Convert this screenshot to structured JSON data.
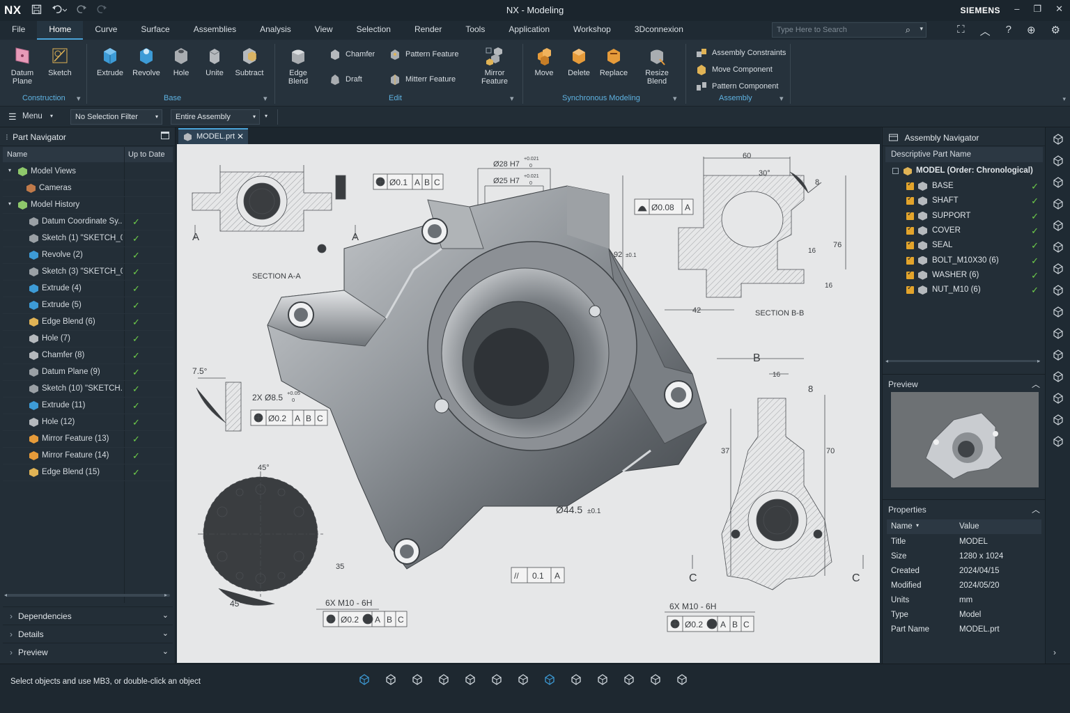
{
  "app": {
    "logo": "NX",
    "title": "NX - Modeling",
    "brand": "SIEMENS"
  },
  "quick_access": {
    "save_icon": "save-icon",
    "undo_icon": "undo-icon",
    "redo_icon": "redo-icon"
  },
  "window_controls": {
    "minimize": "–",
    "restore": "❐",
    "close": "✕"
  },
  "menubar": {
    "items": [
      "File",
      "Home",
      "Curve",
      "Surface",
      "Assemblies",
      "Analysis",
      "View",
      "Selection",
      "Render",
      "Tools",
      "Application",
      "Workshop",
      "3Dconnexion"
    ],
    "active": "Home"
  },
  "search": {
    "placeholder": "Type Here to Search"
  },
  "ribbon": {
    "construction": {
      "group": "Construction",
      "datum_plane": "Datum Plane",
      "sketch": "Sketch"
    },
    "base": {
      "group": "Base",
      "extrude": "Extrude",
      "revolve": "Revolve",
      "hole": "Hole",
      "unite": "Unite",
      "subtract": "Subtract"
    },
    "edit": {
      "group": "Edit",
      "edge_blend": "Edge Blend",
      "chamfer": "Chamfer",
      "draft": "Draft",
      "pattern_feature": "Pattern Feature",
      "mirror_feature_small": "Mitterr Feature",
      "mirror_feature": "Mirror Feature"
    },
    "sync": {
      "group": "Synchronous Modeling",
      "move": "Move",
      "delete": "Delete",
      "replace": "Replace",
      "resize_blend": "Resize Blend"
    },
    "assembly": {
      "group": "Assembly",
      "constraints": "Assembly Constraints",
      "move_component": "Move Component",
      "pattern_component": "Pattern Component"
    }
  },
  "toolbar": {
    "menu_label": "Menu",
    "selection_filter": "No Selection Filter",
    "scope": "Entire Assembly"
  },
  "part_navigator": {
    "title": "Part Navigator",
    "col_name": "Name",
    "col_uptodate": "Up to Date",
    "rows": [
      {
        "label": "Model Views",
        "icon": "model-views-icon",
        "check": ""
      },
      {
        "label": "Cameras",
        "icon": "cameras-icon",
        "check": ""
      },
      {
        "label": "Model History",
        "icon": "model-history-icon",
        "check": ""
      },
      {
        "label": "Datum Coordinate Sy...",
        "icon": "datum-csys-icon",
        "check": "✓"
      },
      {
        "label": "Sketch (1) \"SKETCH_0...",
        "icon": "sketch-icon",
        "check": "✓"
      },
      {
        "label": "Revolve (2)",
        "icon": "revolve-icon",
        "check": "✓"
      },
      {
        "label": "Sketch (3) \"SKETCH_0...",
        "icon": "sketch-icon",
        "check": "✓"
      },
      {
        "label": "Extrude (4)",
        "icon": "extrude-icon",
        "check": "✓"
      },
      {
        "label": "Extrude (5)",
        "icon": "extrude-icon",
        "check": "✓"
      },
      {
        "label": "Edge Blend (6)",
        "icon": "edge-blend-icon",
        "check": "✓"
      },
      {
        "label": "Hole (7)",
        "icon": "hole-icon",
        "check": "✓"
      },
      {
        "label": "Chamfer (8)",
        "icon": "chamfer-icon",
        "check": "✓"
      },
      {
        "label": "Datum Plane (9)",
        "icon": "datum-plane-icon",
        "check": "✓"
      },
      {
        "label": "Sketch (10) \"SKETCH...",
        "icon": "sketch-icon",
        "check": "✓"
      },
      {
        "label": "Extrude (11)",
        "icon": "extrude-icon",
        "check": "✓"
      },
      {
        "label": "Hole (12)",
        "icon": "hole-icon",
        "check": "✓"
      },
      {
        "label": "Mirror Feature (13)",
        "icon": "mirror-feature-icon",
        "check": "✓"
      },
      {
        "label": "Mirror Feature (14)",
        "icon": "mirror-feature-icon",
        "check": "✓"
      },
      {
        "label": "Edge Blend (15)",
        "icon": "edge-blend-icon",
        "check": "✓"
      }
    ],
    "sections": [
      "Dependencies",
      "Details",
      "Preview"
    ]
  },
  "document_tab": {
    "label": "MODEL.prt"
  },
  "drawing": {
    "section_aa": "SECTION A-A",
    "section_bb": "SECTION B-B",
    "label_a": "A",
    "label_b": "B",
    "label_c": "C",
    "fcf_top": [
      "Ø0.1",
      "A",
      "B",
      "C"
    ],
    "dim_28": "Ø28 H7",
    "tol_28_upper": "+0.021",
    "tol_28_lower": "0",
    "dim_25": "Ø25 H7",
    "tol_25_upper": "+0.021",
    "tol_25_lower": "0",
    "profile_fcf": [
      "Ø0.08",
      "A"
    ],
    "dim_60": "60",
    "dim_30deg": "30°",
    "dim_8": "8",
    "dim_92": "92",
    "tol_92": "±0.1",
    "dim_76": "76",
    "dim_16": "16",
    "dim_42": "42",
    "dim_75deg": "7.5°",
    "hole_2x": "2X Ø8.5",
    "tol_hole_upper": "+0.05",
    "tol_hole_lower": "0",
    "fcf_hole": [
      "Ø0.2",
      "A",
      "B",
      "C"
    ],
    "dim_45deg": "45°",
    "dim_35": "35",
    "dim_44": "Ø44.5",
    "tol_44": "±0.1",
    "parallel_fcf": [
      "//",
      "0.1",
      "A"
    ],
    "thread_left": "6X M10 - 6H",
    "fcf_thread_left": [
      "Ø0.2",
      "M",
      "A",
      "B",
      "C"
    ],
    "thread_right": "6X M10 - 6H",
    "fcf_thread_right": [
      "Ø0.2",
      "M",
      "A",
      "B",
      "C"
    ],
    "dim_37": "37",
    "dim_70": "70",
    "square_icon": "square-datum-icon"
  },
  "assembly_navigator": {
    "title": "Assembly Navigator",
    "column": "Descriptive Part Name",
    "root": "MODEL (Order: Chronological)",
    "items": [
      "BASE",
      "SHAFT",
      "SUPPORT",
      "COVER",
      "SEAL",
      "BOLT_M10X30 (6)",
      "WASHER (6)",
      "NUT_M10 (6)"
    ]
  },
  "preview_panel": {
    "title": "Preview"
  },
  "properties": {
    "title": "Properties",
    "col_name": "Name",
    "col_value": "Value",
    "rows": [
      {
        "name": "Title",
        "value": "MODEL"
      },
      {
        "name": "Size",
        "value": "1280 x 1024"
      },
      {
        "name": "Created",
        "value": "2024/04/15"
      },
      {
        "name": "Modified",
        "value": "2024/05/20"
      },
      {
        "name": "Units",
        "value": "mm"
      },
      {
        "name": "Type",
        "value": "Model"
      },
      {
        "name": "Part Name",
        "value": "MODEL.prt"
      }
    ]
  },
  "status": {
    "message": "Select objects and use MB3, or double-click an object"
  },
  "colors": {
    "accent": "#4aa3d8",
    "check_green": "#6fcf4a",
    "checkbox_orange": "#e3a42b",
    "group_label": "#5fb3e2"
  }
}
